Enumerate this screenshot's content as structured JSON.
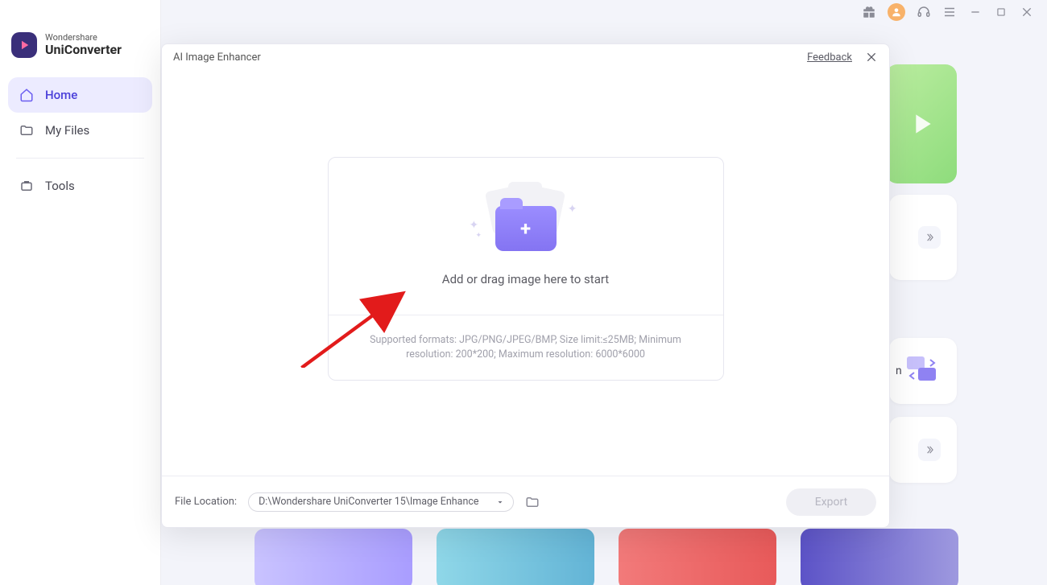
{
  "app": {
    "brand_line1": "Wondershare",
    "brand_line2": "UniConverter"
  },
  "sidebar": {
    "items": [
      {
        "label": "Home",
        "icon": "home-icon",
        "active": true
      },
      {
        "label": "My Files",
        "icon": "files-icon",
        "active": false
      },
      {
        "label": "Tools",
        "icon": "tools-icon",
        "active": false
      }
    ]
  },
  "titlebar": {
    "icons": [
      "gift-icon",
      "avatar-icon",
      "headset-icon",
      "hamburger-icon",
      "minimize-icon",
      "maximize-icon",
      "close-icon"
    ]
  },
  "dialog": {
    "title": "AI Image Enhancer",
    "feedback_label": "Feedback",
    "drop_prompt": "Add or drag image here to start",
    "support_text": "Supported formats: JPG/PNG/JPEG/BMP, Size limit:≤25MB; Minimum resolution: 200*200; Maximum resolution: 6000*6000",
    "file_location_label": "File Location:",
    "file_location_path": "D:\\Wondershare UniConverter 15\\Image Enhance",
    "export_label": "Export"
  },
  "background_cards": {
    "card_text_fragment": "n"
  }
}
